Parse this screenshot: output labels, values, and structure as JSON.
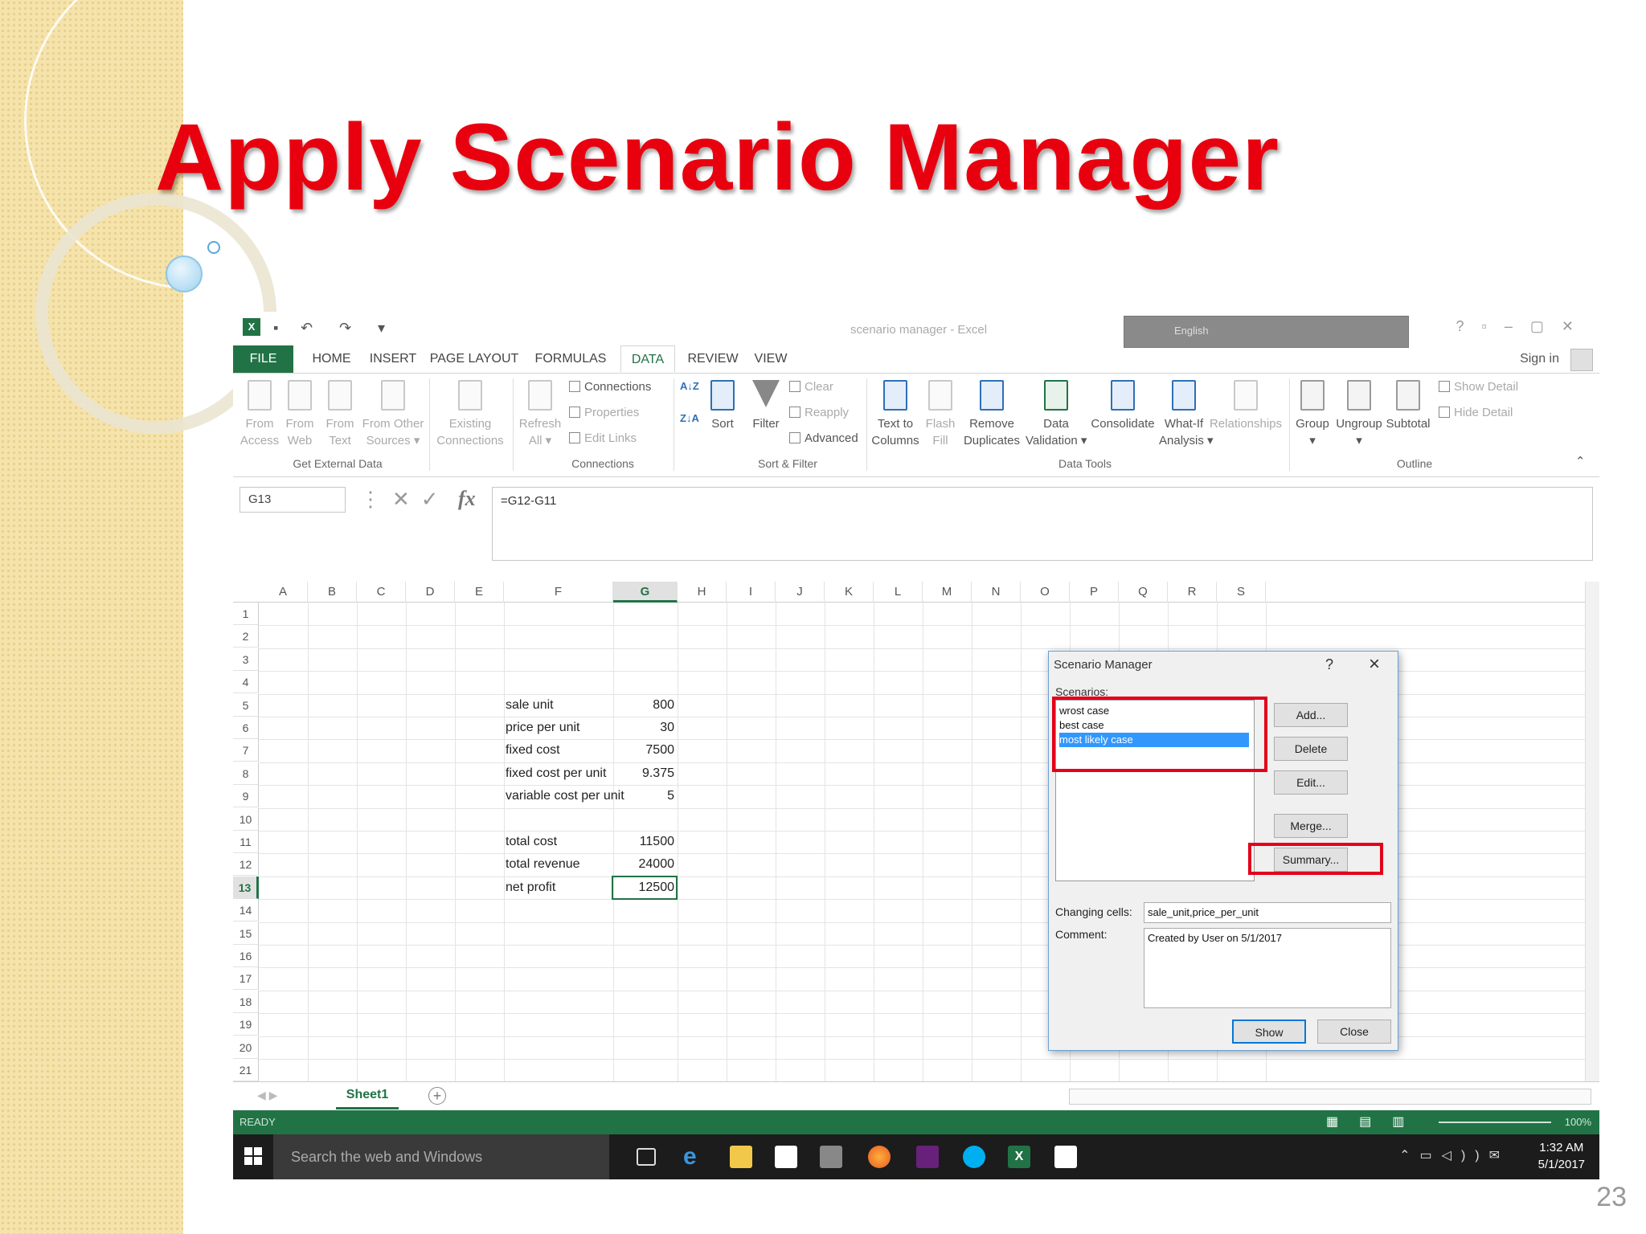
{
  "slide": {
    "title": "Apply Scenario Manager",
    "page_number": "23",
    "title_color": "#e8000f"
  },
  "excel": {
    "window_title": "scenario manager - Excel",
    "language_bar": "English",
    "sign_in": "Sign in",
    "tabs": [
      "FILE",
      "HOME",
      "INSERT",
      "PAGE LAYOUT",
      "FORMULAS",
      "DATA",
      "REVIEW",
      "VIEW"
    ],
    "active_tab": "DATA",
    "ribbon": {
      "get_external_data": {
        "group": "Get External Data",
        "from_access": "From\nAccess",
        "from_web": "From\nWeb",
        "from_text": "From\nText",
        "from_other": "From Other\nSources ▾"
      },
      "existing_connections": "Existing\nConnections",
      "refresh_all": "Refresh\nAll ▾",
      "connections": {
        "group": "Connections",
        "connections": "Connections",
        "properties": "Properties",
        "edit_links": "Edit Links"
      },
      "sort_filter": {
        "group": "Sort & Filter",
        "sort": "Sort",
        "filter": "Filter",
        "clear": "Clear",
        "reapply": "Reapply",
        "advanced": "Advanced"
      },
      "data_tools": {
        "group": "Data Tools",
        "text_to_columns": "Text to\nColumns",
        "flash_fill": "Flash\nFill",
        "remove_duplicates": "Remove\nDuplicates",
        "data_validation": "Data\nValidation ▾",
        "consolidate": "Consolidate",
        "what_if": "What-If\nAnalysis ▾",
        "relationships": "Relationships"
      },
      "outline": {
        "group": "Outline",
        "group_btn": "Group\n▾",
        "ungroup": "Ungroup\n▾",
        "subtotal": "Subtotal",
        "show_detail": "Show Detail",
        "hide_detail": "Hide Detail"
      }
    },
    "name_box": "G13",
    "formula": "=G12-G11",
    "columns": [
      "A",
      "B",
      "C",
      "D",
      "E",
      "F",
      "G",
      "H",
      "I",
      "J",
      "K",
      "L",
      "M",
      "N",
      "O",
      "P",
      "Q",
      "R",
      "S"
    ],
    "selected_column": "G",
    "rows": [
      "1",
      "2",
      "3",
      "4",
      "5",
      "6",
      "7",
      "8",
      "9",
      "10",
      "11",
      "12",
      "13",
      "14",
      "15",
      "16",
      "17",
      "18",
      "19",
      "20",
      "21"
    ],
    "selected_row": "13",
    "cells": [
      {
        "row": 5,
        "label": "sale unit",
        "value": "800"
      },
      {
        "row": 6,
        "label": "price per unit",
        "value": "30"
      },
      {
        "row": 7,
        "label": "fixed cost",
        "value": "7500"
      },
      {
        "row": 8,
        "label": "fixed cost per unit",
        "value": "9.375"
      },
      {
        "row": 9,
        "label": "variable cost per unit",
        "value": "5"
      },
      {
        "row": 11,
        "label": "total cost",
        "value": "11500"
      },
      {
        "row": 12,
        "label": "total revenue",
        "value": "24000"
      },
      {
        "row": 13,
        "label": "net profit",
        "value": "12500"
      }
    ],
    "sheet_tab": "Sheet1",
    "status": "READY",
    "zoom": "100%",
    "taskbar": {
      "search_placeholder": "Search the web and Windows",
      "time": "1:32 AM",
      "date": "5/1/2017"
    }
  },
  "dialog": {
    "title": "Scenario Manager",
    "help": "?",
    "scenarios_label": "Scenarios:",
    "scenarios": [
      "wrost case",
      "best case",
      "most likely case"
    ],
    "selected_scenario": "most likely case",
    "buttons": {
      "add": "Add...",
      "delete": "Delete",
      "edit": "Edit...",
      "merge": "Merge...",
      "summary": "Summary...",
      "show": "Show",
      "close": "Close"
    },
    "changing_cells_label": "Changing cells:",
    "changing_cells": "sale_unit,price_per_unit",
    "comment_label": "Comment:",
    "comment": "Created by User on 5/1/2017",
    "highlight_color": "#e3001b"
  }
}
